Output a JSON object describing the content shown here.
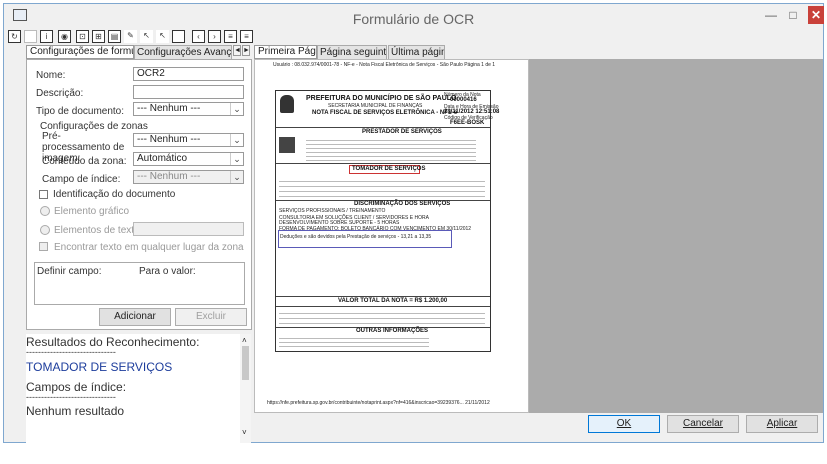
{
  "window": {
    "title": "Formulário de OCR",
    "minimize": "—",
    "maximize": "□",
    "close": "✕"
  },
  "left_tabs": [
    "Configurações de formulário",
    "Configurações Avançadas"
  ],
  "nav_prev": "◄",
  "nav_next": "►",
  "form": {
    "nome_label": "Nome:",
    "nome_value": "OCR2",
    "descricao_label": "Descrição:",
    "descricao_value": "",
    "tipo_label": "Tipo de documento:",
    "tipo_value": "--- Nenhum ---",
    "zonas_group": "Configurações de zonas",
    "preproc_label": "Pré-processamento de imagem:",
    "preproc_value": "--- Nenhum ---",
    "conteudo_label": "Conteúdo da zona:",
    "conteudo_value": "Automático",
    "campo_label": "Campo de índice:",
    "campo_value": "--- Nenhum ---",
    "identificacao_label": "Identificação do documento",
    "elemento_grafico": "Elemento gráfico",
    "elementos_texto": "Elementos de texto:",
    "encontrar_texto": "Encontrar texto em qualquer lugar da zona",
    "definir_campo": "Definir campo:",
    "para_valor": "Para o valor:",
    "adicionar": "Adicionar",
    "excluir": "Excluir"
  },
  "results": {
    "heading": "Resultados do Reconhecimento:",
    "sep1": "------------------------------",
    "value": "TOMADOR DE SERVIÇOS",
    "campos": "Campos de índice:",
    "sep2": "------------------------------",
    "nenhum": "Nenhum resultado"
  },
  "preview_tabs": [
    "Primeira Página",
    "Página seguintes",
    "Última página"
  ],
  "doc": {
    "header_line": "Usuário : 08.032.974/0001-78 - NF-e - Nota Fiscal Eletrônica de Serviços - São Paulo          Página 1 de 1",
    "prefeitura": "PREFEITURA DO MUNICÍPIO DE SÃO PAULO",
    "secretaria": "SECRETARIA MUNICIPAL DE FINANÇAS",
    "nota": "NOTA FISCAL DE SERVIÇOS ELETRÔNICA - NFS-e",
    "numero_label": "Número da Nota",
    "numero": "00000416",
    "data_label": "Data e Hora de Emissão",
    "data": "21/11/2012 12:51:08",
    "codigo_label": "Código de Verificação",
    "codigo": "F6EE-BOSK",
    "prestador": "PRESTADOR DE SERVIÇOS",
    "tomador": "TOMADOR DE SERVIÇOS",
    "discriminacao": "DISCRIMINAÇÃO DOS SERVIÇOS",
    "servicos_line1": "SERVIÇOS PROFISSIONAIS / TREINAMENTO",
    "servicos_line2": "CONSULTORIA EM SOLUÇÕES CLIENT / SERVIDORES E HORA",
    "servicos_line3": "DESENVOLVIMENTO SOBRE SUPORTE - 5 HORAS",
    "servicos_line4": "FORMA DE PAGAMENTO: BOLETO BANCÁRIO COM VENCIMENTO EM 30/11/2012",
    "servicos_line5": "Deduções e são devidos pela Prestação de serviços - 13,21 a 13,35",
    "valor_total": "VALOR TOTAL DA NOTA = R$ 1.200,00",
    "outras": "OUTRAS INFORMAÇÕES",
    "footer_url": "https://nfe.prefeitura.sp.gov.br/contribuinte/notaprint.aspx?nf=416&inscricao=39239376...      21/11/2012"
  },
  "buttons": {
    "ok": "OK",
    "cancelar": "Cancelar",
    "aplicar": "Aplicar"
  },
  "toolbar_icons": [
    "refresh-icon",
    "open-icon",
    "info-icon",
    "preview-icon",
    "fit-icon",
    "zoom-icon",
    "select-icon",
    "zone-icon",
    "pointer-icon",
    "rectangle-icon",
    "prev-page-icon",
    "next-page-icon",
    "page-icon",
    "page2-icon"
  ]
}
